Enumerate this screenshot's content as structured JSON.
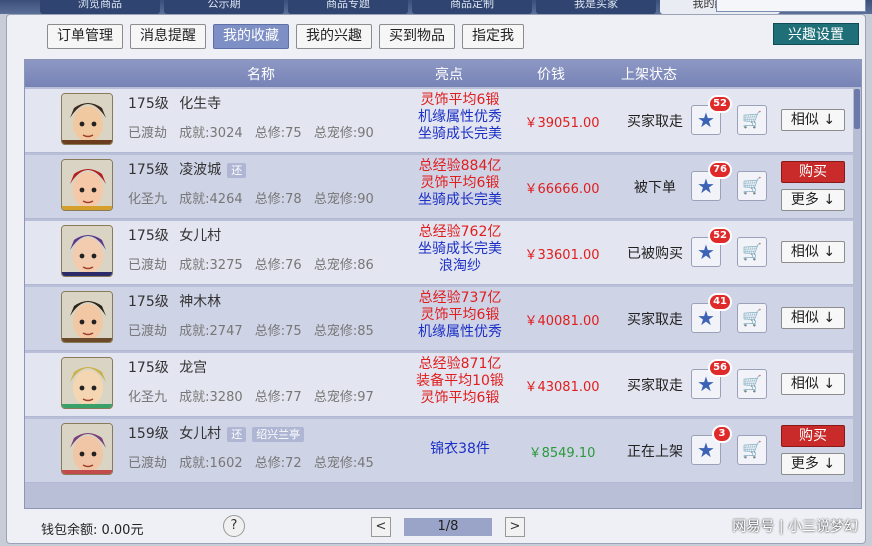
{
  "top_tabs": [
    {
      "label": "浏览商品",
      "active": false
    },
    {
      "label": "公示期",
      "active": false
    },
    {
      "label": "商品专题",
      "active": false
    },
    {
      "label": "商品定制",
      "active": false
    },
    {
      "label": "我是买家",
      "active": false
    },
    {
      "label": "我的藏宝阁",
      "active": true
    }
  ],
  "subtabs": [
    {
      "label": "订单管理",
      "active": false
    },
    {
      "label": "消息提醒",
      "active": false
    },
    {
      "label": "我的收藏",
      "active": true
    },
    {
      "label": "我的兴趣",
      "active": false
    },
    {
      "label": "买到物品",
      "active": false
    },
    {
      "label": "指定我",
      "active": false
    }
  ],
  "settings_label": "兴趣设置",
  "table_header": {
    "name": "名称",
    "highlights": "亮点",
    "price": "价钱",
    "status": "上架状态"
  },
  "rows": [
    {
      "level_text": "175级",
      "name": "化生寺",
      "tags": [],
      "stats": {
        "state": "已渡劫",
        "achievement": "成就:3024",
        "total_cult": "总修:75",
        "pet_cult": "总宠修:90"
      },
      "highlights": [
        {
          "text": "灵饰平均6锻",
          "color": "red"
        },
        {
          "text": "机缘属性优秀",
          "color": "blue"
        },
        {
          "text": "坐骑成长完美",
          "color": "blue"
        }
      ],
      "price": "￥39051.00",
      "price_color": "red",
      "status": "买家取走",
      "fav_count": "52",
      "buttons": [
        {
          "label": "相似 ↓",
          "style": "white"
        }
      ]
    },
    {
      "level_text": "175级",
      "name": "凌波城",
      "tags": [
        "还"
      ],
      "stats": {
        "state": "化圣九",
        "achievement": "成就:4264",
        "total_cult": "总修:78",
        "pet_cult": "总宠修:90"
      },
      "highlights": [
        {
          "text": "总经验884亿",
          "color": "red"
        },
        {
          "text": "灵饰平均6锻",
          "color": "red"
        },
        {
          "text": "坐骑成长完美",
          "color": "blue"
        }
      ],
      "price": "￥66666.00",
      "price_color": "red",
      "status": "被下单",
      "fav_count": "76",
      "buttons": [
        {
          "label": "购买",
          "style": "red"
        },
        {
          "label": "更多 ↓",
          "style": "white"
        }
      ]
    },
    {
      "level_text": "175级",
      "name": "女儿村",
      "tags": [],
      "stats": {
        "state": "已渡劫",
        "achievement": "成就:3275",
        "total_cult": "总修:76",
        "pet_cult": "总宠修:86"
      },
      "highlights": [
        {
          "text": "总经验762亿",
          "color": "red"
        },
        {
          "text": "坐骑成长完美",
          "color": "blue"
        },
        {
          "text": "浪淘纱",
          "color": "blue"
        }
      ],
      "price": "￥33601.00",
      "price_color": "red",
      "status": "已被购买",
      "fav_count": "52",
      "buttons": [
        {
          "label": "相似 ↓",
          "style": "white"
        }
      ]
    },
    {
      "level_text": "175级",
      "name": "神木林",
      "tags": [],
      "stats": {
        "state": "已渡劫",
        "achievement": "成就:2747",
        "total_cult": "总修:75",
        "pet_cult": "总宠修:85"
      },
      "highlights": [
        {
          "text": "总经验737亿",
          "color": "red"
        },
        {
          "text": "灵饰平均6锻",
          "color": "red"
        },
        {
          "text": "机缘属性优秀",
          "color": "blue"
        }
      ],
      "price": "￥40081.00",
      "price_color": "red",
      "status": "买家取走",
      "fav_count": "41",
      "buttons": [
        {
          "label": "相似 ↓",
          "style": "white"
        }
      ]
    },
    {
      "level_text": "175级",
      "name": "龙宫",
      "tags": [],
      "stats": {
        "state": "化圣九",
        "achievement": "成就:3280",
        "total_cult": "总修:77",
        "pet_cult": "总宠修:97"
      },
      "highlights": [
        {
          "text": "总经验871亿",
          "color": "red"
        },
        {
          "text": "装备平均10锻",
          "color": "red"
        },
        {
          "text": "灵饰平均6锻",
          "color": "red"
        }
      ],
      "price": "￥43081.00",
      "price_color": "red",
      "status": "买家取走",
      "fav_count": "56",
      "buttons": [
        {
          "label": "相似 ↓",
          "style": "white"
        }
      ]
    },
    {
      "level_text": "159级",
      "name": "女儿村",
      "tags": [
        "还",
        "绍兴兰亭"
      ],
      "stats": {
        "state": "已渡劫",
        "achievement": "成就:1602",
        "total_cult": "总修:72",
        "pet_cult": "总宠修:45"
      },
      "highlights": [
        {
          "text": "锦衣38件",
          "color": "blue"
        }
      ],
      "price": "￥8549.10",
      "price_color": "green",
      "status": "正在上架",
      "fav_count": "3",
      "buttons": [
        {
          "label": "购买",
          "style": "red"
        },
        {
          "label": "更多 ↓",
          "style": "white"
        }
      ]
    }
  ],
  "footer": {
    "balance": "钱包余额: 0.00元",
    "help": "?",
    "page": "1/8",
    "prev": "<",
    "next": ">"
  },
  "watermark": "网易号 | 小三说梦幻"
}
